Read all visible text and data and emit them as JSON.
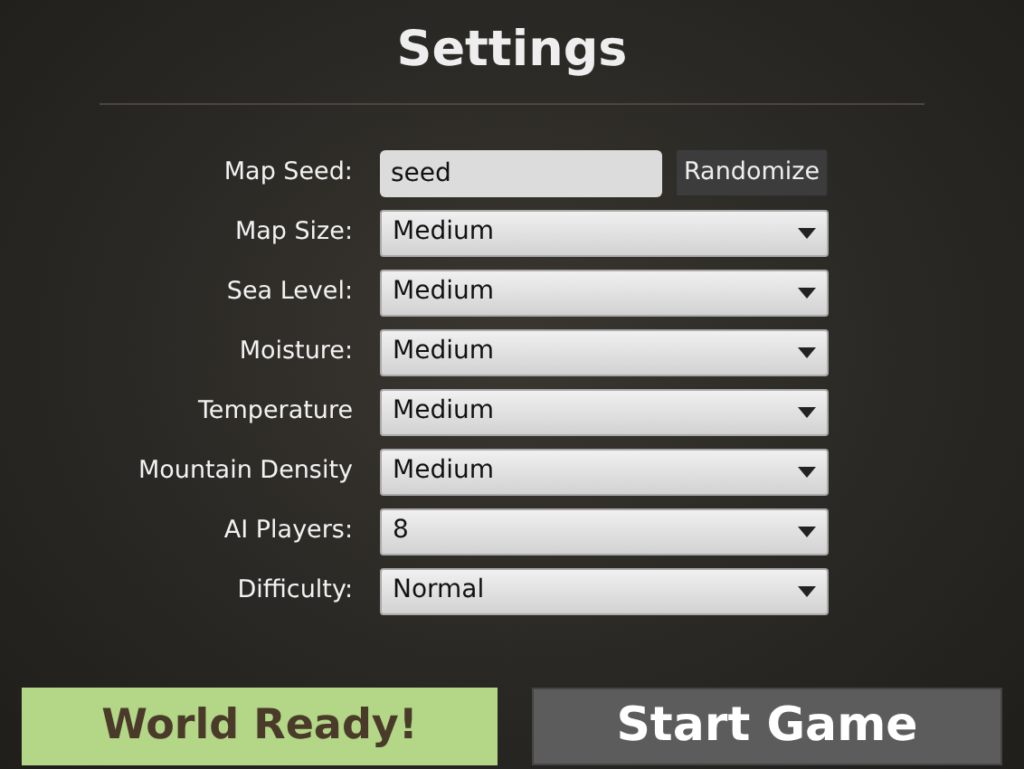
{
  "title": "Settings",
  "fields": [
    {
      "kind": "text",
      "label": "Map Seed:",
      "value": "seed",
      "button": "Randomize"
    },
    {
      "kind": "select",
      "label": "Map Size:",
      "value": "Medium"
    },
    {
      "kind": "select",
      "label": "Sea Level:",
      "value": "Medium"
    },
    {
      "kind": "select",
      "label": "Moisture:",
      "value": "Medium"
    },
    {
      "kind": "select",
      "label": "Temperature",
      "value": "Medium"
    },
    {
      "kind": "select",
      "label": "Mountain Density",
      "value": "Medium"
    },
    {
      "kind": "select",
      "label": "AI Players:",
      "value": "8"
    },
    {
      "kind": "select",
      "label": "Difficulty:",
      "value": "Normal"
    }
  ],
  "status": "World Ready!",
  "start_button": "Start Game"
}
